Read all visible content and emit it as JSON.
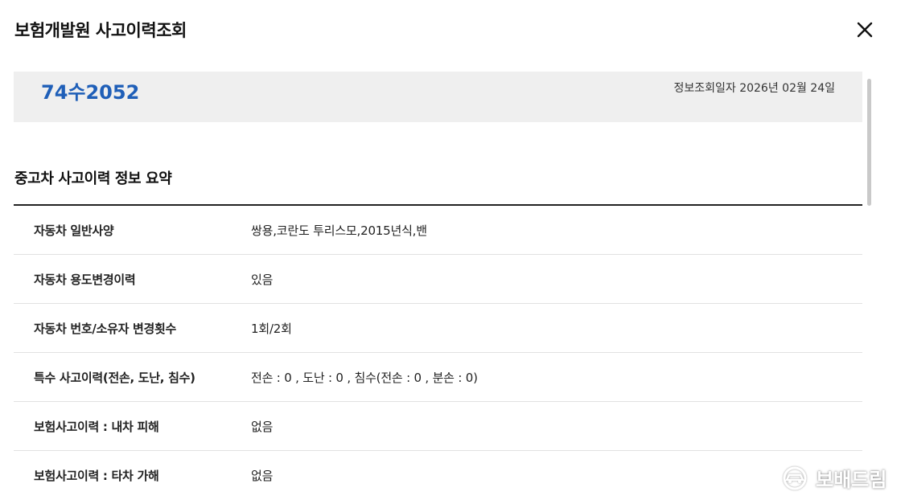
{
  "modal": {
    "title": "보험개발원 사고이력조회",
    "close_icon": "close-icon"
  },
  "vehicle": {
    "plate_number": "74수2052",
    "query_date": "정보조회일자 2026년 02월 24일"
  },
  "summary": {
    "title": "중고차 사고이력 정보 요약",
    "rows": [
      {
        "label": "자동차 일반사양",
        "value": "쌍용,코란도 투리스모,2015년식,밴"
      },
      {
        "label": "자동차 용도변경이력",
        "value": "있음"
      },
      {
        "label": "자동차 번호/소유자 변경횟수",
        "value": "1회/2회"
      },
      {
        "label": "특수 사고이력(전손, 도난, 침수)",
        "value": "전손 : 0 , 도난 : 0 , 침수(전손 : 0 , 분손 : 0)"
      },
      {
        "label": "보험사고이력 : 내차 피해",
        "value": "없음"
      },
      {
        "label": "보험사고이력 : 타차 가해",
        "value": "없음"
      }
    ]
  },
  "watermark": {
    "text": "보배드림",
    "icon": "car-logo-icon"
  }
}
